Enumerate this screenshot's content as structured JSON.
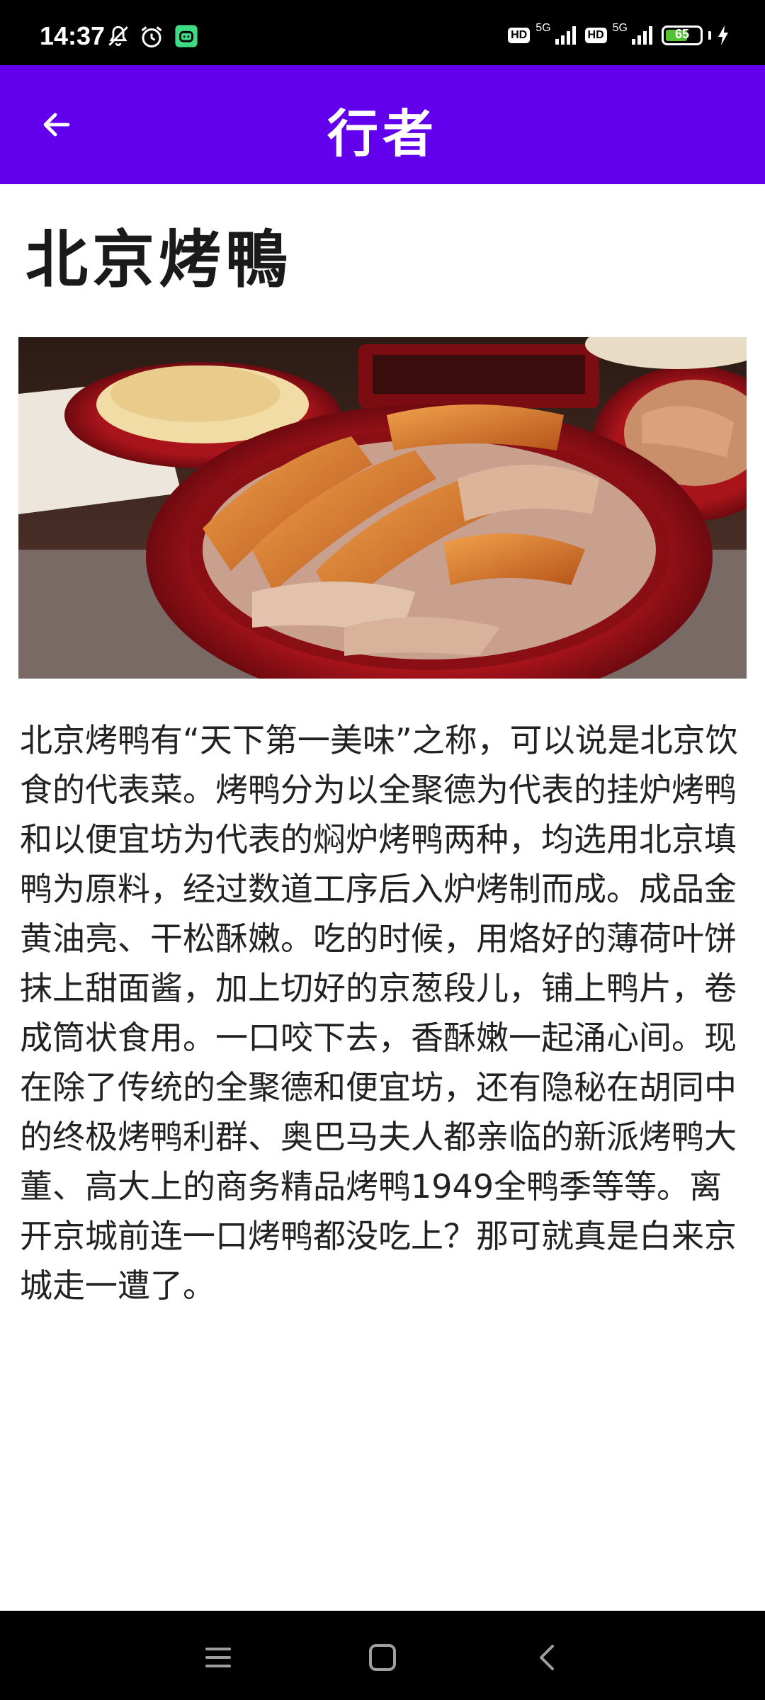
{
  "status_bar": {
    "time": "14:37",
    "icons": [
      "bell-off-icon",
      "alarm-icon",
      "android-app-icon"
    ],
    "hd1": "HD",
    "net1": "5G",
    "hd2": "HD",
    "net2": "5G",
    "battery": "65",
    "battery_level": 0.65
  },
  "app_bar": {
    "title": "行者",
    "back_icon": "arrow-left-icon",
    "color": "#6200ee"
  },
  "article": {
    "heading": "北京烤鴨",
    "image_icon": "roast-duck-photo",
    "body": "北京烤鸭有“天下第一美味”之称，可以说是北京饮食的代表菜。烤鸭分为以全聚德为代表的挂炉烤鸭和以便宜坊为代表的焖炉烤鸭两种，均选用北京填鸭为原料，经过数道工序后入炉烤制而成。成品金黄油亮、干松酥嫩。吃的时候，用烙好的薄荷叶饼抹上甜面酱，加上切好的京葱段儿，铺上鸭片，卷成筒状食用。一口咬下去，香酥嫩一起涌心间。现在除了传统的全聚德和便宜坊，还有隐秘在胡同中的终极烤鸭利群、奥巴马夫人都亲临的新派烤鸭大董、高大上的商务精品烤鸭1949全鸭季等等。离开京城前连一口烤鸭都没吃上？那可就真是白来京城走一遭了。"
  },
  "nav_bar": {
    "icons": [
      "menu-icon",
      "home-icon",
      "back-icon"
    ]
  }
}
